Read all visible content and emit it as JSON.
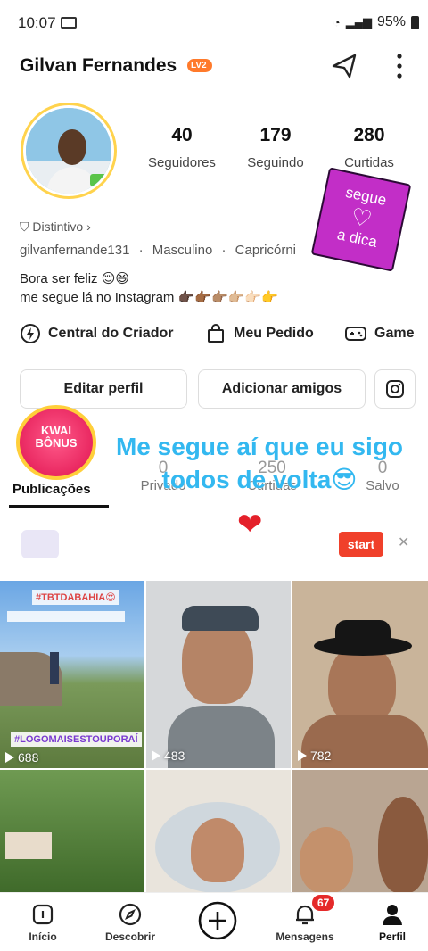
{
  "status_bar": {
    "time": "10:07",
    "battery": "95%"
  },
  "profile": {
    "name": "Gilvan Fernandes",
    "level": "LV2",
    "stats": [
      {
        "value": "40",
        "label": "Seguidores"
      },
      {
        "value": "179",
        "label": "Seguindo"
      },
      {
        "value": "280",
        "label": "Curtidas"
      }
    ],
    "badge_text": "Distintivo",
    "username": "gilvanfernande131",
    "gender": "Masculino",
    "sign": "Capricórni",
    "bio_line1": "Bora ser feliz 😌😆",
    "bio_line2": "me segue lá no Instagram 👉🏿👉🏾👉🏽👉🏼👉🏻👉"
  },
  "sticker": {
    "line1": "segue",
    "line2": "a dica"
  },
  "actions": [
    {
      "label": "Central do Criador",
      "icon": "creator-bolt-icon"
    },
    {
      "label": "Meu Pedido",
      "icon": "shopping-bag-icon"
    },
    {
      "label": "Game",
      "icon": "gamepad-icon"
    }
  ],
  "buttons": {
    "edit": "Editar perfil",
    "add": "Adicionar amigos"
  },
  "kwai_bonus": {
    "line1": "KWAI",
    "line2": "BÔNUS"
  },
  "overlay_text": "Me segue aí que eu sigo todos de volta😎",
  "tabs": {
    "publications": "Publicações",
    "counts": [
      {
        "value": "0",
        "label": "Privado"
      },
      {
        "value": "250",
        "label": "Curtidas"
      },
      {
        "value": "0",
        "label": "Salvo"
      }
    ]
  },
  "ad": {
    "start": "start"
  },
  "posts": [
    {
      "views": "688",
      "caption_top": "#TBTDABAHIA😍",
      "caption_bottom": "#LOGOMAISESTOUPORAÍ"
    },
    {
      "views": "483"
    },
    {
      "views": "782"
    }
  ],
  "nav": {
    "items": [
      {
        "label": "Início",
        "icon": "home-icon"
      },
      {
        "label": "Descobrir",
        "icon": "compass-icon"
      },
      {
        "label": "",
        "icon": "plus-icon"
      },
      {
        "label": "Mensagens",
        "icon": "bell-icon"
      },
      {
        "label": "Perfil",
        "icon": "person-icon"
      }
    ],
    "messages_badge": "67"
  },
  "colors": {
    "accent": "#f0402a",
    "overlay_text": "#33b8f0",
    "sticker": "#c22ec7",
    "level_badge": "#ff7a2b"
  }
}
